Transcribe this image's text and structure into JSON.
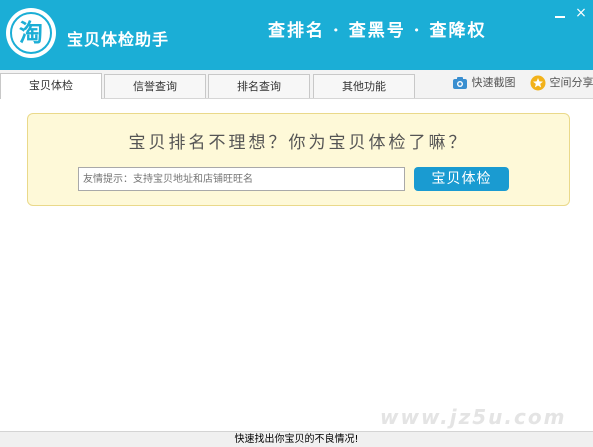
{
  "header": {
    "logo_char": "淘",
    "app_title": "宝贝体检助手",
    "slogan": "查排名 · 查黑号 · 查降权",
    "background_color": "#1baed6",
    "minimize_icon": "minimize-icon",
    "close_label": "×"
  },
  "tabs": [
    {
      "label": "宝贝体检",
      "active": true
    },
    {
      "label": "信誉查询",
      "active": false
    },
    {
      "label": "排名查询",
      "active": false
    },
    {
      "label": "其他功能",
      "active": false
    }
  ],
  "toolbar": {
    "screenshot_label": "快速截图",
    "screenshot_icon": "camera-icon",
    "share_label": "空间分享",
    "share_icon": "star-icon"
  },
  "main": {
    "headline": "宝贝排名不理想？你为宝贝体检了嘛？",
    "search_placeholder": "友情提示：支持宝贝地址和店铺旺旺名",
    "check_button": "宝贝体检",
    "panel_color": "#fef9d8",
    "button_color": "#1a9bd1"
  },
  "watermark": "www.jz5u.com",
  "status": {
    "text": "快速找出你宝贝的不良情况!"
  }
}
